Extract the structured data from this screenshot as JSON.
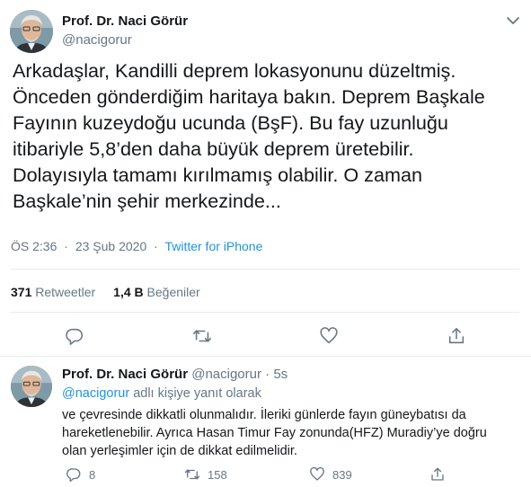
{
  "tweet": {
    "author_name": "Prof. Dr. Naci Görür",
    "author_handle": "@nacigorur",
    "text_lines": [
      "Arkadaşlar, Kandilli deprem lokasyonunu düzeltmiş.",
      "Önceden gönderdiğim haritaya bakın. Deprem Başkale",
      "Fayının kuzeydoğu ucunda (BşF). Bu fay uzunluğu",
      "itibariyle 5,8’den daha büyük deprem üretebilir.",
      "Dolayısıyla tamamı kırılmamış olabilir. O zaman",
      "Başkale’nin şehir merkezinde..."
    ],
    "time": "ÖS 2:36",
    "date": "23 Şub 2020",
    "meta_separator": "·",
    "source": "Twitter for iPhone",
    "retweets_count": "371",
    "retweets_label": "Retweetler",
    "likes_count": "1,4 B",
    "likes_label": "Beğeniler"
  },
  "reply": {
    "author_name": "Prof. Dr. Naci Görür",
    "author_handle": "@nacigorur",
    "dot": "·",
    "time": "5s",
    "context_mention": "@nacigorur",
    "context_text": " adlı kişiye yanıt olarak",
    "text_lines": [
      "ve çevresinde dikkatli olunmalıdır. İleriki günlerde fayın güneybatısı da",
      "hareketlenebilir. Ayrıca Hasan Timur Fay zonunda(HFZ) Muradiy’ye doğru",
      "olan yerleşimler için de dikkat edilmelidir."
    ],
    "reply_count": "8",
    "retweet_count": "158",
    "like_count": "839"
  },
  "icons": {
    "caret": "chevron-down-icon",
    "reply": "reply-icon",
    "retweet": "retweet-icon",
    "like": "heart-icon",
    "share": "share-icon"
  },
  "colors": {
    "text": "#14171a",
    "secondary": "#657786",
    "link": "#1b95e0",
    "divider": "#e6ecf0"
  }
}
